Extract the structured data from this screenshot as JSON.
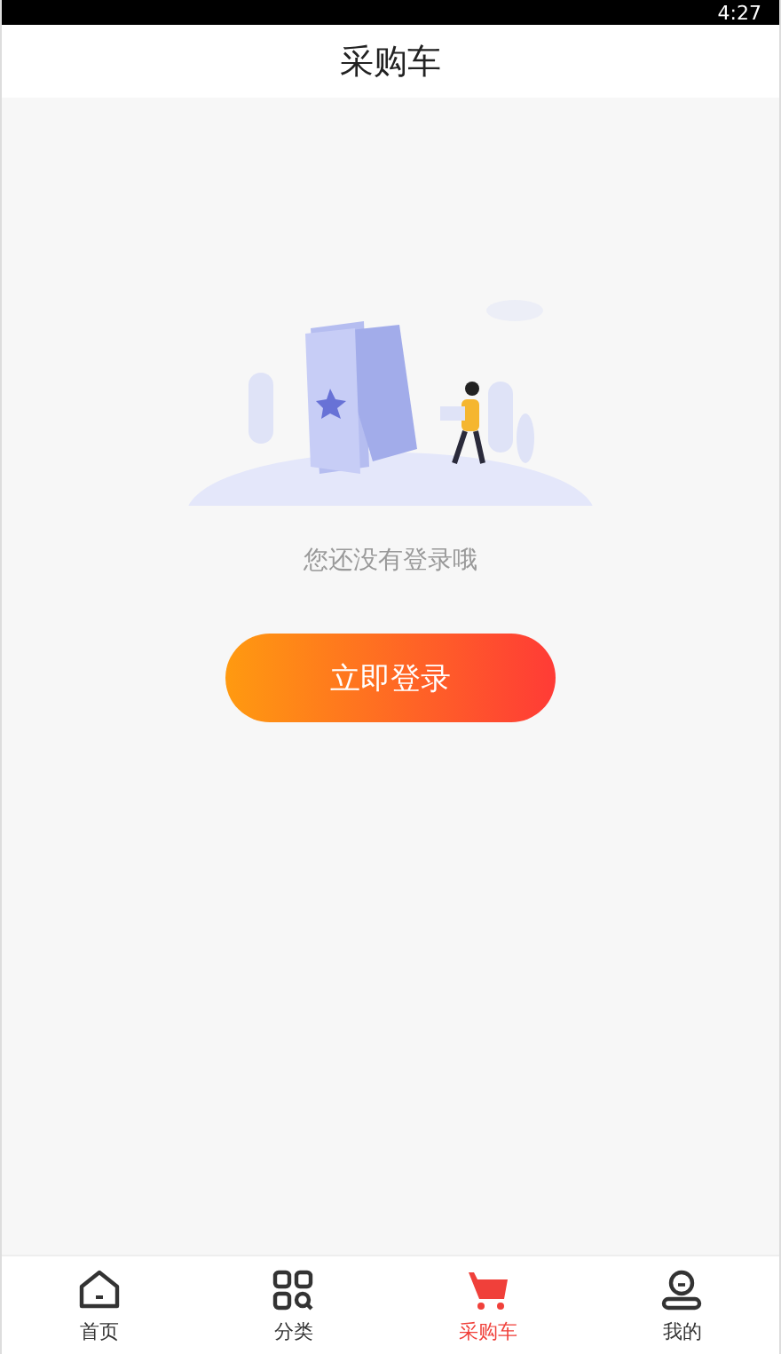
{
  "status_bar": {
    "time": "4:27"
  },
  "header": {
    "title": "采购车"
  },
  "empty_state": {
    "message": "您还没有登录哦",
    "button": "立即登录"
  },
  "tabs": [
    {
      "label": "首页",
      "kind": "home",
      "selected": false
    },
    {
      "label": "分类",
      "kind": "category",
      "selected": false
    },
    {
      "label": "采购车",
      "kind": "cart",
      "selected": true
    },
    {
      "label": "我的",
      "kind": "profile",
      "selected": false
    }
  ]
}
